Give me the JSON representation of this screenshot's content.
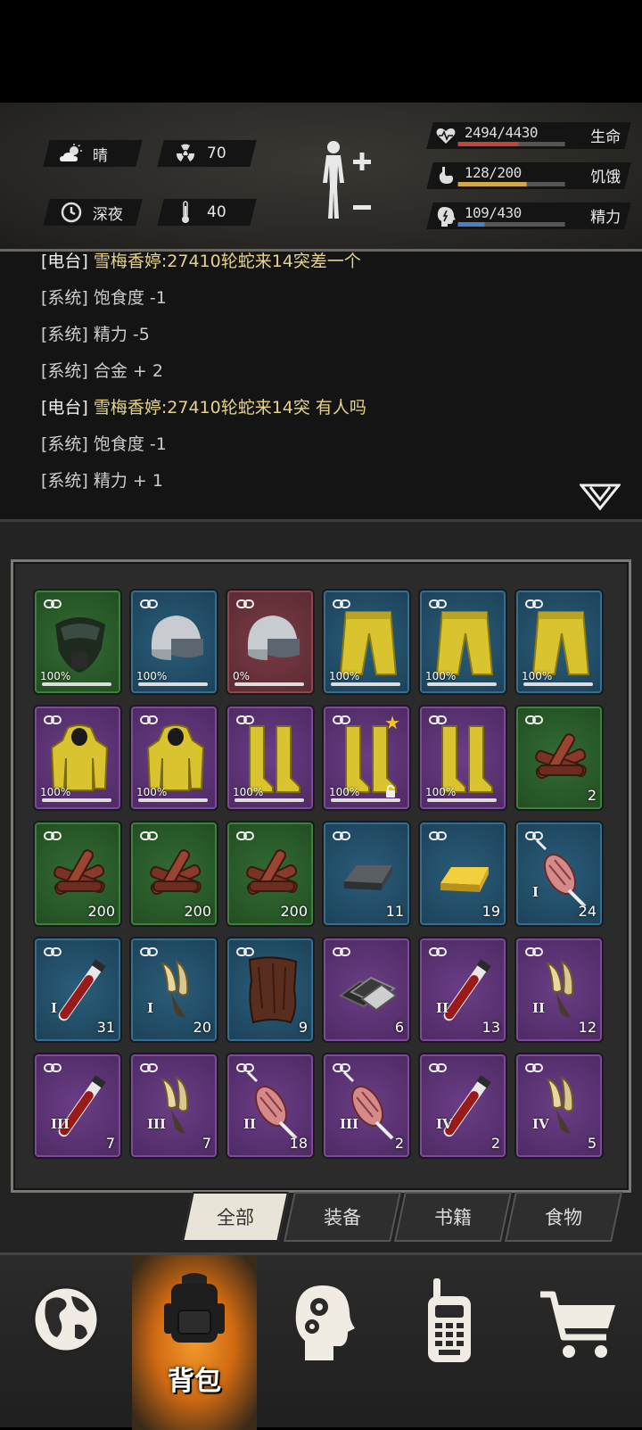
{
  "weather": {
    "label": "晴",
    "icon": "cloud-sun-icon"
  },
  "radiation": {
    "value": "70",
    "icon": "radiation-icon"
  },
  "time_of_day": {
    "label": "深夜",
    "icon": "clock-icon"
  },
  "temperature": {
    "value": "40",
    "icon": "thermometer-icon"
  },
  "stats": [
    {
      "name": "生命",
      "value": "2494/4430",
      "ratio": 0.563,
      "color": "#c0463a",
      "icon": "heart-icon"
    },
    {
      "name": "饥饿",
      "value": "128/200",
      "ratio": 0.64,
      "color": "#d4a84a",
      "icon": "stomach-icon"
    },
    {
      "name": "精力",
      "value": "109/430",
      "ratio": 0.253,
      "color": "#4a7fc0",
      "icon": "brain-icon"
    }
  ],
  "log": [
    {
      "tag": "[电台]",
      "msg": " 雪梅香婷:27410轮蛇来14突差一个",
      "type": "radio"
    },
    {
      "tag": "[系统]",
      "msg": " 饱食度 -1",
      "type": "system"
    },
    {
      "tag": "[系统]",
      "msg": " 精力 -5",
      "type": "system"
    },
    {
      "tag": "[系统]",
      "msg": " 合金 + 2",
      "type": "system"
    },
    {
      "tag": "[电台]",
      "msg": " 雪梅香婷:27410轮蛇来14突 有人吗",
      "type": "radio"
    },
    {
      "tag": "[系统]",
      "msg": " 饱食度 -1",
      "type": "system"
    },
    {
      "tag": "[系统]",
      "msg": " 精力 + 1",
      "type": "system"
    }
  ],
  "items": [
    {
      "rarity": "green",
      "icon": "gas-mask-icon",
      "durability": "100%"
    },
    {
      "rarity": "blue",
      "icon": "helmet-icon",
      "durability": "100%"
    },
    {
      "rarity": "red",
      "icon": "helmet-icon",
      "durability": "0%"
    },
    {
      "rarity": "blue",
      "icon": "pants-icon",
      "durability": "100%"
    },
    {
      "rarity": "blue",
      "icon": "pants-icon",
      "durability": "100%"
    },
    {
      "rarity": "blue",
      "icon": "pants-icon",
      "durability": "100%"
    },
    {
      "rarity": "purple",
      "icon": "hazmat-jacket-icon",
      "durability": "100%"
    },
    {
      "rarity": "purple",
      "icon": "hazmat-jacket-icon",
      "durability": "100%"
    },
    {
      "rarity": "purple",
      "icon": "boots-icon",
      "durability": "100%"
    },
    {
      "rarity": "purple",
      "icon": "boots-icon",
      "durability": "100%",
      "star": true,
      "locked": true
    },
    {
      "rarity": "purple",
      "icon": "boots-icon",
      "durability": "100%"
    },
    {
      "rarity": "green",
      "icon": "wood-pile-icon",
      "qty": "2"
    },
    {
      "rarity": "green",
      "icon": "wood-pile-icon",
      "qty": "200"
    },
    {
      "rarity": "green",
      "icon": "wood-pile-icon",
      "qty": "200"
    },
    {
      "rarity": "green",
      "icon": "wood-pile-icon",
      "qty": "200"
    },
    {
      "rarity": "blue",
      "icon": "iron-ingot-icon",
      "qty": "11"
    },
    {
      "rarity": "blue",
      "icon": "gold-ingot-icon",
      "qty": "19"
    },
    {
      "rarity": "blue",
      "icon": "meat-leg-icon",
      "qty": "24",
      "tier": "I"
    },
    {
      "rarity": "blue",
      "icon": "blood-vial-icon",
      "qty": "31",
      "tier": "I"
    },
    {
      "rarity": "blue",
      "icon": "claw-icon",
      "qty": "20",
      "tier": "I"
    },
    {
      "rarity": "blue",
      "icon": "leather-icon",
      "qty": "9"
    },
    {
      "rarity": "purple",
      "icon": "metal-plates-icon",
      "qty": "6"
    },
    {
      "rarity": "purple",
      "icon": "blood-vial-icon",
      "qty": "13",
      "tier": "II"
    },
    {
      "rarity": "purple",
      "icon": "claw-icon",
      "qty": "12",
      "tier": "II"
    },
    {
      "rarity": "purple",
      "icon": "blood-vial-icon",
      "qty": "7",
      "tier": "III"
    },
    {
      "rarity": "purple",
      "icon": "claw-icon",
      "qty": "7",
      "tier": "III"
    },
    {
      "rarity": "purple",
      "icon": "meat-leg-icon",
      "qty": "18",
      "tier": "II"
    },
    {
      "rarity": "purple",
      "icon": "meat-leg-icon",
      "qty": "2",
      "tier": "III"
    },
    {
      "rarity": "purple",
      "icon": "blood-vial-icon",
      "qty": "2",
      "tier": "IV"
    },
    {
      "rarity": "purple",
      "icon": "claw-icon",
      "qty": "5",
      "tier": "IV"
    }
  ],
  "tabs": [
    {
      "label": "全部",
      "active": true
    },
    {
      "label": "装备",
      "active": false
    },
    {
      "label": "书籍",
      "active": false
    },
    {
      "label": "食物",
      "active": false
    }
  ],
  "nav": [
    {
      "label": "",
      "icon": "globe-icon",
      "active": false
    },
    {
      "label": "背包",
      "icon": "backpack-icon",
      "active": true
    },
    {
      "label": "",
      "icon": "head-gears-icon",
      "active": false
    },
    {
      "label": "",
      "icon": "walkie-talkie-icon",
      "active": false
    },
    {
      "label": "",
      "icon": "shopping-cart-icon",
      "active": false
    }
  ]
}
